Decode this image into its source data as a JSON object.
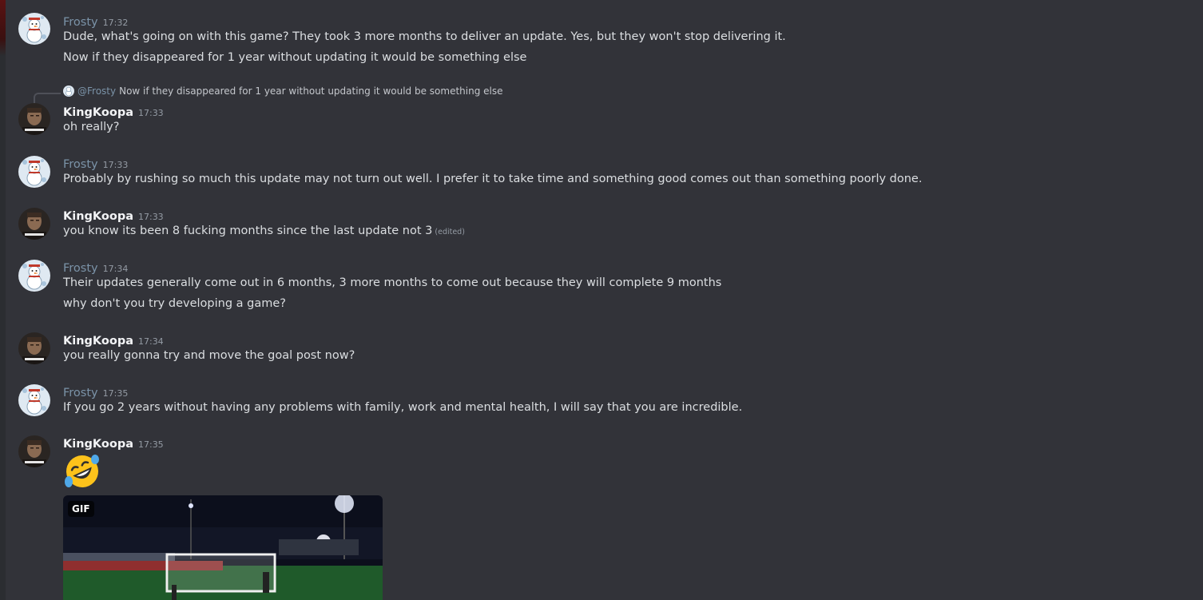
{
  "users": {
    "frosty": {
      "name": "Frosty",
      "color": "#7b93a8"
    },
    "koopa": {
      "name": "KingKoopa",
      "color": "#f2f3f5"
    }
  },
  "reply": {
    "mention": "@Frosty",
    "text": "Now if they disappeared for 1 year without updating it would be something else"
  },
  "messages": [
    {
      "author": "Frosty",
      "time": "17:32",
      "lines": [
        "Dude, what's going on with this game? They took 3 more months to deliver an update. Yes, but they won't stop delivering it.",
        "Now if they disappeared for 1 year without updating it would be something else"
      ]
    },
    {
      "author": "KingKoopa",
      "time": "17:33",
      "lines": [
        "oh really?"
      ]
    },
    {
      "author": "Frosty",
      "time": "17:33",
      "lines": [
        "Probably by rushing so much this update may not turn out well. I prefer it to take time and something good comes out than something poorly done."
      ]
    },
    {
      "author": "KingKoopa",
      "time": "17:33",
      "lines": [
        "you know its been 8 fucking months since the last update not 3"
      ],
      "edited": "(edited)"
    },
    {
      "author": "Frosty",
      "time": "17:34",
      "lines": [
        "Their updates generally come out in 6 months, 3 more months to come out because they will complete 9 months",
        "why don't you try developing a game?"
      ]
    },
    {
      "author": "KingKoopa",
      "time": "17:34",
      "lines": [
        "you really gonna try and move the goal post now?"
      ]
    },
    {
      "author": "Frosty",
      "time": "17:35",
      "lines": [
        "If you go 2 years without having any problems with family, work and mental health, I will say that you are incredible."
      ]
    },
    {
      "author": "KingKoopa",
      "time": "17:35",
      "emoji": "rolling-on-floor-laughing",
      "gif_label": "GIF"
    }
  ]
}
